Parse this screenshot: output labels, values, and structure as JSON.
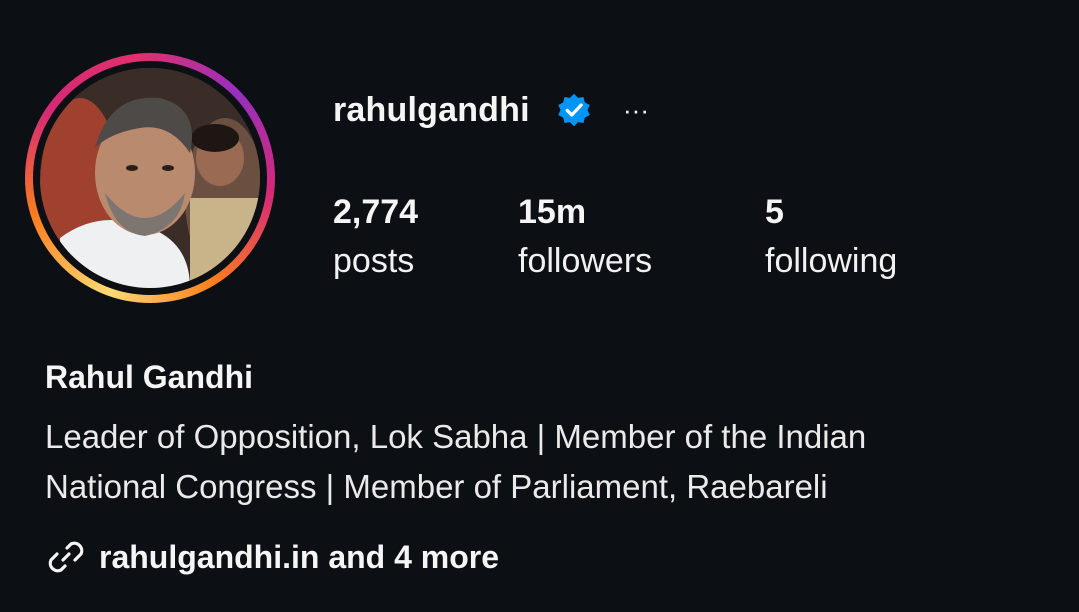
{
  "profile": {
    "username": "rahulgandhi",
    "verified_icon": "verified-badge-icon",
    "more_icon": "more-options-icon",
    "more_glyph": "···",
    "full_name": "Rahul Gandhi",
    "bio_line1": "Leader of Opposition, Lok Sabha | Member of the Indian",
    "bio_line2": "National Congress | Member of Parliament, Raebareli",
    "link_icon": "link-icon",
    "link_text": "rahulgandhi.in and 4 more"
  },
  "stats": {
    "posts": {
      "value": "2,774",
      "label": "posts"
    },
    "followers": {
      "value": "15m",
      "label": "followers"
    },
    "following": {
      "value": "5",
      "label": "following"
    }
  },
  "colors": {
    "background": "#0c0f14",
    "text": "#f5f5f5",
    "verified": "#0095f6",
    "story_ring": [
      "#feda75",
      "#fa7e1e",
      "#d62976",
      "#962fbf"
    ]
  }
}
